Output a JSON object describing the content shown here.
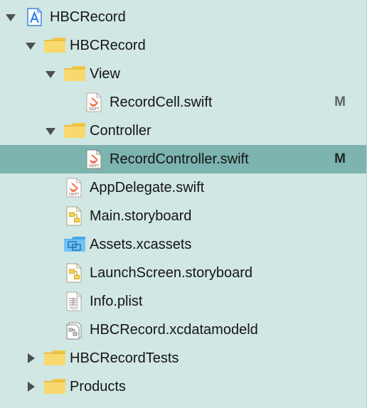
{
  "project_navigator": {
    "items": [
      {
        "label": "HBCRecord",
        "status": ""
      },
      {
        "label": "HBCRecord",
        "status": ""
      },
      {
        "label": "View",
        "status": ""
      },
      {
        "label": "RecordCell.swift",
        "status": "M"
      },
      {
        "label": "Controller",
        "status": ""
      },
      {
        "label": "RecordController.swift",
        "status": "M"
      },
      {
        "label": "AppDelegate.swift",
        "status": ""
      },
      {
        "label": "Main.storyboard",
        "status": ""
      },
      {
        "label": "Assets.xcassets",
        "status": ""
      },
      {
        "label": "LaunchScreen.storyboard",
        "status": ""
      },
      {
        "label": "Info.plist",
        "status": ""
      },
      {
        "label": "HBCRecord.xcdatamodeld",
        "status": ""
      },
      {
        "label": "HBCRecordTests",
        "status": ""
      },
      {
        "label": "Products",
        "status": ""
      }
    ],
    "selected_item": "RecordController.swift",
    "colors": {
      "background": "#d1e7e4",
      "selection": "#7cb4af",
      "folder": "#f6d35a",
      "asset_folder": "#5fb5f0",
      "swift": "#ef6f4f",
      "text": "#151515",
      "status": "#5d6565"
    }
  }
}
